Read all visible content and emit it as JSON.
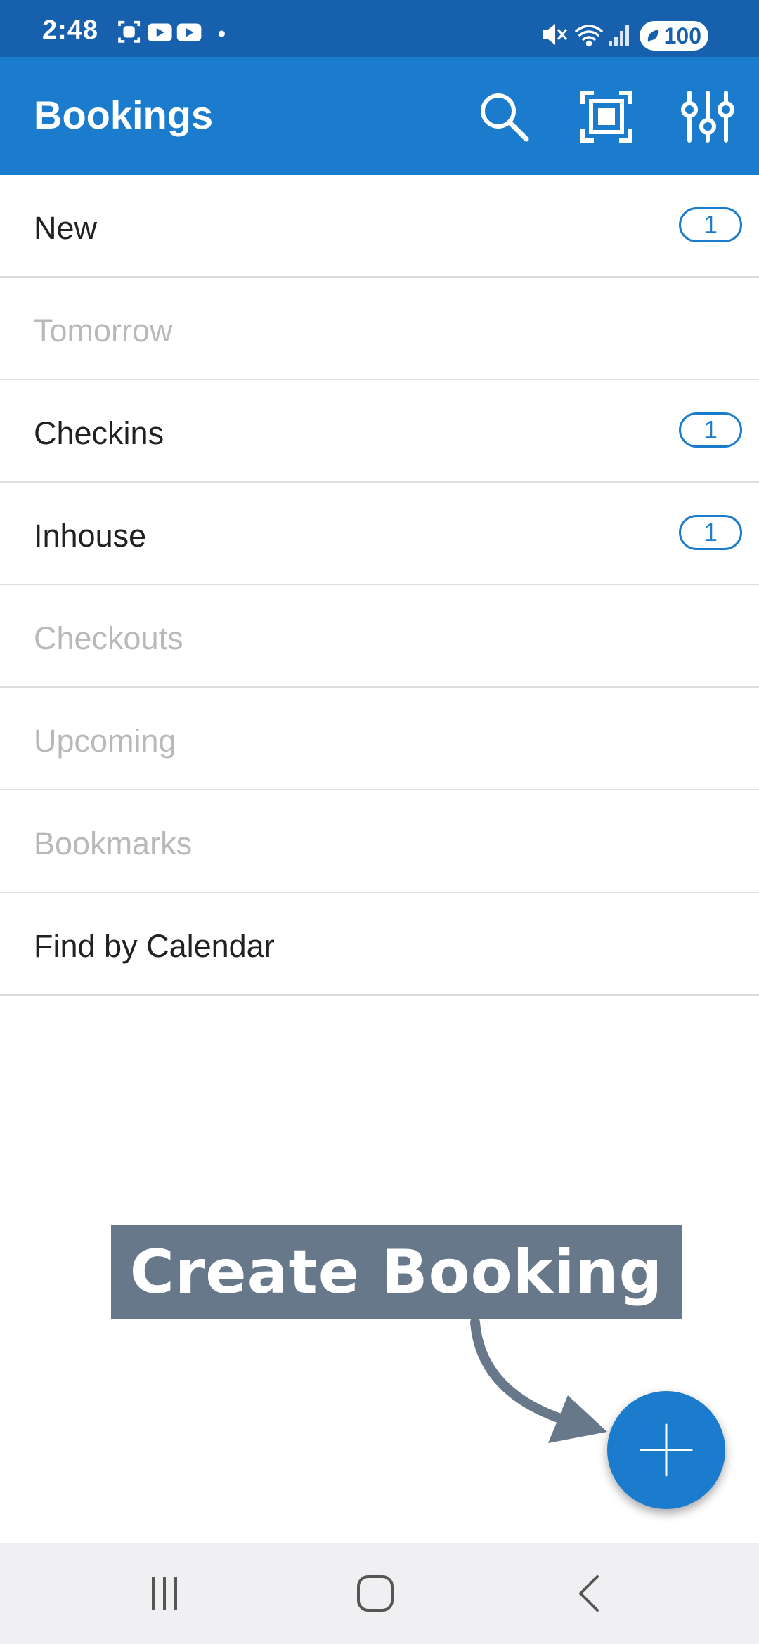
{
  "status_bar": {
    "time": "2:48",
    "battery": "100",
    "icons_left": [
      "screenshot-icon",
      "youtube-icon",
      "youtube-icon",
      "dot-icon"
    ],
    "icons_right": [
      "mute-icon",
      "wifi-icon",
      "signal-icon",
      "battery-icon"
    ]
  },
  "app_bar": {
    "title": "Bookings",
    "actions": [
      "search-icon",
      "scan-icon",
      "filter-sliders-icon"
    ]
  },
  "list": {
    "items": [
      {
        "label": "New",
        "badge": "1",
        "enabled": true
      },
      {
        "label": "Tomorrow",
        "badge": null,
        "enabled": false
      },
      {
        "label": "Checkins",
        "badge": "1",
        "enabled": true
      },
      {
        "label": "Inhouse",
        "badge": "1",
        "enabled": true
      },
      {
        "label": "Checkouts",
        "badge": null,
        "enabled": false
      },
      {
        "label": "Upcoming",
        "badge": null,
        "enabled": false
      },
      {
        "label": "Bookmarks",
        "badge": null,
        "enabled": false
      },
      {
        "label": "Find by Calendar",
        "badge": null,
        "enabled": true
      }
    ]
  },
  "callout": {
    "text": "Create Booking"
  },
  "fab": {
    "icon": "plus-icon"
  },
  "nav_bar": {
    "buttons": [
      "recents-icon",
      "home-icon",
      "back-icon"
    ]
  },
  "colors": {
    "status_bar": "#1760ae",
    "app_bar": "#1b7bcc",
    "accent": "#1b7bcc",
    "callout": "#67788a",
    "disabled_text": "#b9b9b9",
    "divider": "#dedede",
    "nav_bar": "#f0f0f2"
  }
}
